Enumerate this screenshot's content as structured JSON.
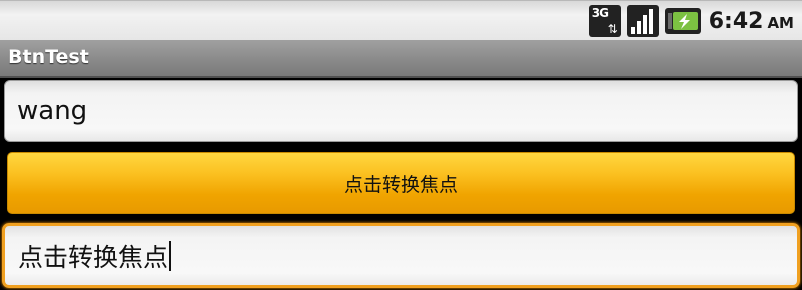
{
  "status_bar": {
    "network_label": "3G",
    "network_icon": "3g-data-icon",
    "signal_icon": "signal-strength-icon",
    "battery_icon": "battery-charging-icon",
    "time": "6:42",
    "ampm": "AM"
  },
  "app": {
    "title": "BtnTest"
  },
  "form": {
    "edit1_value": "wang",
    "button_label": "点击转换焦点",
    "edit2_value": "点击转换焦点"
  },
  "colors": {
    "button_accent": "#f0a400",
    "focus_border": "#f0a020"
  }
}
